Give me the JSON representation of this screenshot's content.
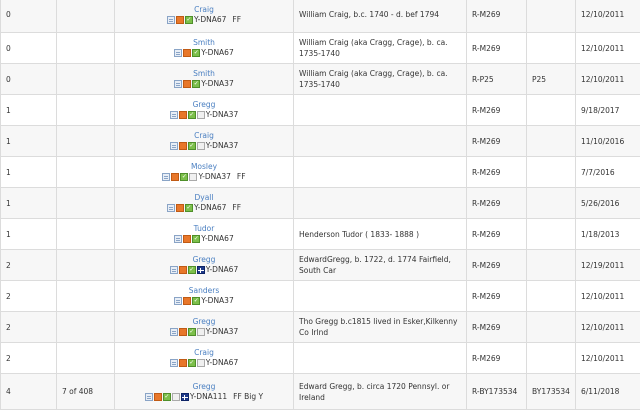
{
  "rows": [
    {
      "gd": "0",
      "count": "",
      "name": "Craig",
      "icons": [
        "doc-icon",
        "tree-icon",
        "check-icon"
      ],
      "test": "Y-DNA67",
      "extras": "FF",
      "ancestor": "William Craig, b.c. 1740 - d. bef 1794",
      "haplo": "R-M269",
      "terminal": "",
      "date": "12/10/2011"
    },
    {
      "gd": "0",
      "count": "",
      "name": "Smith",
      "icons": [
        "doc-icon",
        "tree-icon",
        "check-icon"
      ],
      "test": "Y-DNA67",
      "extras": "",
      "ancestor": "William Craig (aka Cragg, Crage), b. ca. 1735-1740",
      "haplo": "R-M269",
      "terminal": "",
      "date": "12/10/2011"
    },
    {
      "gd": "0",
      "count": "",
      "name": "Smith",
      "icons": [
        "doc-icon",
        "tree-icon",
        "check-icon"
      ],
      "test": "Y-DNA37",
      "extras": "",
      "ancestor": "William Craig (aka Cragg, Crage), b. ca. 1735-1740",
      "haplo": "R-P25",
      "terminal": "P25",
      "date": "12/10/2011"
    },
    {
      "gd": "1",
      "count": "",
      "name": "Gregg",
      "icons": [
        "doc-icon",
        "tree-icon",
        "check-icon",
        "map-icon"
      ],
      "test": "Y-DNA37",
      "extras": "",
      "ancestor": "",
      "haplo": "R-M269",
      "terminal": "",
      "date": "9/18/2017"
    },
    {
      "gd": "1",
      "count": "",
      "name": "Craig",
      "icons": [
        "doc-icon",
        "tree-icon",
        "check-icon",
        "map-icon"
      ],
      "test": "Y-DNA37",
      "extras": "",
      "ancestor": "",
      "haplo": "R-M269",
      "terminal": "",
      "date": "11/10/2016"
    },
    {
      "gd": "1",
      "count": "",
      "name": "Mosley",
      "icons": [
        "doc-icon",
        "tree-icon",
        "check-icon",
        "map-icon"
      ],
      "test": "Y-DNA37",
      "extras": "FF",
      "ancestor": "",
      "haplo": "R-M269",
      "terminal": "",
      "date": "7/7/2016"
    },
    {
      "gd": "1",
      "count": "",
      "name": "Dyall",
      "icons": [
        "doc-icon",
        "tree-icon",
        "check-icon"
      ],
      "test": "Y-DNA67",
      "extras": "FF",
      "ancestor": "",
      "haplo": "R-M269",
      "terminal": "",
      "date": "5/26/2016"
    },
    {
      "gd": "1",
      "count": "",
      "name": "Tudor",
      "icons": [
        "doc-icon",
        "tree-icon",
        "check-icon"
      ],
      "test": "Y-DNA67",
      "extras": "",
      "ancestor": "Henderson Tudor ( 1833- 1888 )",
      "haplo": "R-M269",
      "terminal": "",
      "date": "1/18/2013"
    },
    {
      "gd": "2",
      "count": "",
      "name": "Gregg",
      "icons": [
        "doc-icon",
        "tree-icon",
        "check-icon",
        "flag-icon"
      ],
      "test": "Y-DNA67",
      "extras": "",
      "ancestor": "EdwardGregg, b. 1722, d. 1774 Fairfield, South Car",
      "haplo": "R-M269",
      "terminal": "",
      "date": "12/19/2011"
    },
    {
      "gd": "2",
      "count": "",
      "name": "Sanders",
      "icons": [
        "doc-icon",
        "tree-icon",
        "check-icon"
      ],
      "test": "Y-DNA37",
      "extras": "",
      "ancestor": "",
      "haplo": "R-M269",
      "terminal": "",
      "date": "12/10/2011"
    },
    {
      "gd": "2",
      "count": "",
      "name": "Gregg",
      "icons": [
        "doc-icon",
        "tree-icon",
        "check-icon",
        "map-icon"
      ],
      "test": "Y-DNA37",
      "extras": "",
      "ancestor": "Tho Gregg b.c1815 lived in Esker,Kilkenny Co Irlnd",
      "haplo": "R-M269",
      "terminal": "",
      "date": "12/10/2011"
    },
    {
      "gd": "2",
      "count": "",
      "name": "Craig",
      "icons": [
        "doc-icon",
        "tree-icon",
        "check-icon",
        "map-icon"
      ],
      "test": "Y-DNA67",
      "extras": "",
      "ancestor": "",
      "haplo": "R-M269",
      "terminal": "",
      "date": "12/10/2011"
    },
    {
      "gd": "4",
      "count": "7 of 408",
      "name": "Gregg",
      "icons": [
        "doc-icon",
        "tree-icon",
        "check-icon",
        "map-icon",
        "flag-icon"
      ],
      "test": "Y-DNA111",
      "extras": "FF  Big Y",
      "ancestor": "Edward Gregg, b. circa 1720 Pennsyl. or Ireland",
      "haplo": "R-BY173534",
      "terminal": "BY173534",
      "date": "6/11/2018"
    }
  ]
}
